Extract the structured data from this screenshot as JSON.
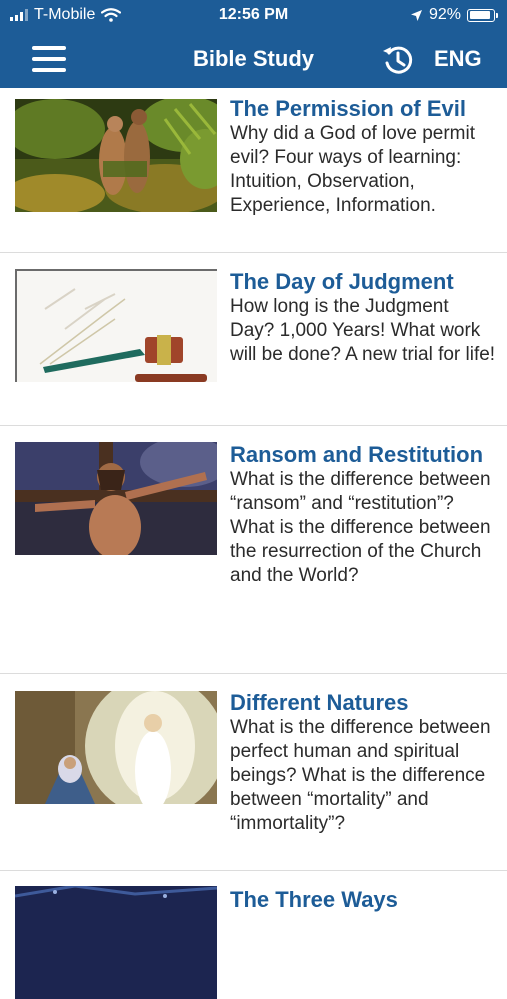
{
  "status_bar": {
    "carrier": "T-Mobile",
    "time": "12:56 PM",
    "battery": "92%",
    "battery_level": 0.92,
    "icons": [
      "signal-icon",
      "wifi-icon",
      "location-arrow-icon",
      "battery-icon"
    ]
  },
  "nav": {
    "title": "Bible Study",
    "language": "ENG",
    "icons": [
      "menu-icon",
      "history-icon"
    ]
  },
  "studies": [
    {
      "title": "The Permission of Evil",
      "description": "Why did a God of love permit evil?  Four ways of learning: Intuition, Observation, Experience, Information."
    },
    {
      "title": "The Day of Judgment",
      "description": "How long is the Judgment Day? 1,000 Years! What work will be done? A new trial for life!"
    },
    {
      "title": "Ransom and Restitution",
      "description": "What is the difference between “ransom” and “restitution”? What is the difference between the resurrection of the Church and the World?"
    },
    {
      "title": "Different Natures",
      "description": "What is the difference between perfect human and spiritual beings? What is the difference between “mortality” and “immortality”?"
    },
    {
      "title": "The Three Ways",
      "description": ""
    }
  ]
}
